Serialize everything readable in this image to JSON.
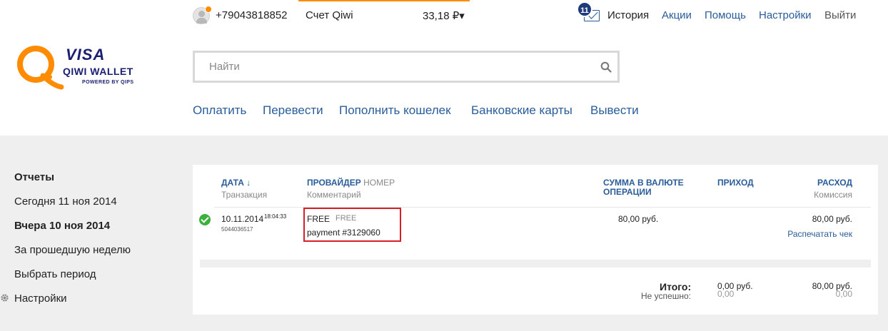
{
  "header": {
    "logo": {
      "brand_top": "VISA",
      "brand_main": "QIWI WALLET",
      "powered": "POWERED BY QIPS"
    },
    "phone": "+79043818852",
    "account_name": "Счет Qiwi",
    "balance": "33,18 ₽",
    "balance_caret": "▾",
    "notifications_count": "11",
    "nav": {
      "history": "История",
      "promo": "Акции",
      "help": "Помощь",
      "settings": "Настройки",
      "logout": "Выйти"
    },
    "search": {
      "placeholder": "Найти",
      "value": ""
    },
    "main_nav": [
      "Оплатить",
      "Перевести",
      "Пополнить кошелек",
      "Банковские карты",
      "Вывести"
    ]
  },
  "sidebar": {
    "title": "Отчеты",
    "items": [
      "Сегодня 11 ноя 2014",
      "Вчера 10 ноя 2014",
      "За прошедшую неделю",
      "Выбрать период",
      "Настройки"
    ],
    "active_index": 1
  },
  "table": {
    "headers": {
      "date": "ДАТА ↓",
      "date_sub": "Транзакция",
      "provider": "ПРОВАЙДЕР",
      "provider_num": "НОМЕР",
      "provider_sub": "Комментарий",
      "amount_line1": "СУММА В ВАЛЮТЕ",
      "amount_line2": "ОПЕРАЦИИ",
      "income": "ПРИХОД",
      "expense": "РАСХОД",
      "expense_sub": "Комиссия"
    },
    "rows": [
      {
        "status": "success",
        "date": "10.11.2014",
        "time": "18:04:33",
        "transaction": "5044036517",
        "provider": "FREE",
        "number": "FREE",
        "comment": "payment #3129060",
        "amount": "80,00 руб.",
        "income": "",
        "expense": "80,00 руб.",
        "print_label": "Распечатать чек"
      }
    ],
    "totals": {
      "label": "Итого:",
      "fail_label": "Не успешно:",
      "income": "0,00 руб.",
      "income_fail": "0,00",
      "expense": "80,00 руб.",
      "expense_fail": "0,00"
    }
  },
  "colors": {
    "accent": "#ff8c00",
    "link": "#2a5c99",
    "highlight": "#d62027",
    "success": "#3bb03b"
  }
}
